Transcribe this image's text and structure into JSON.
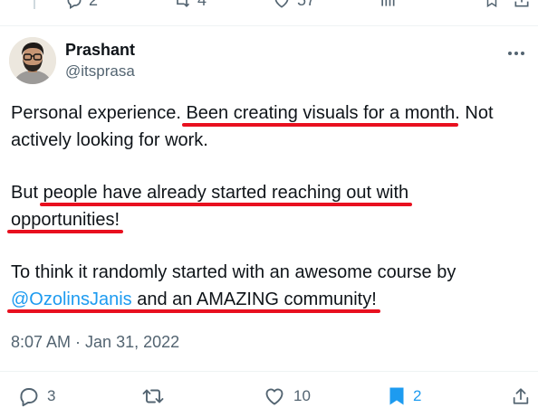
{
  "top_actions": {
    "reply_count": "2",
    "repost_count": "4",
    "like_count": "57"
  },
  "author": {
    "name": "Prashant",
    "handle": "@itsprasa"
  },
  "tweet": {
    "p1_a": "Personal experience. ",
    "p1_mark": "Been creating visuals for a month",
    "p1_b": ". Not actively looking for work.",
    "p2_a": "But ",
    "p2_mark1": "people have already started reaching out with",
    "p2_mark2": "opportunities!",
    "p3_a": "To think it randomly started with an awesome course by ",
    "p3_mention": "@OzolinsJanis",
    "p3_mark": " and an AMAZING community!"
  },
  "timestamp": {
    "time": "8:07 AM",
    "separator": " · ",
    "date": "Jan 31, 2022"
  },
  "actions": {
    "reply_count": "3",
    "repost_count": "",
    "like_count": "10",
    "bookmark_count": "2"
  },
  "colors": {
    "text": "#0f1419",
    "secondary": "#536471",
    "link": "#1d9bf0",
    "highlight": "#e8101f"
  }
}
